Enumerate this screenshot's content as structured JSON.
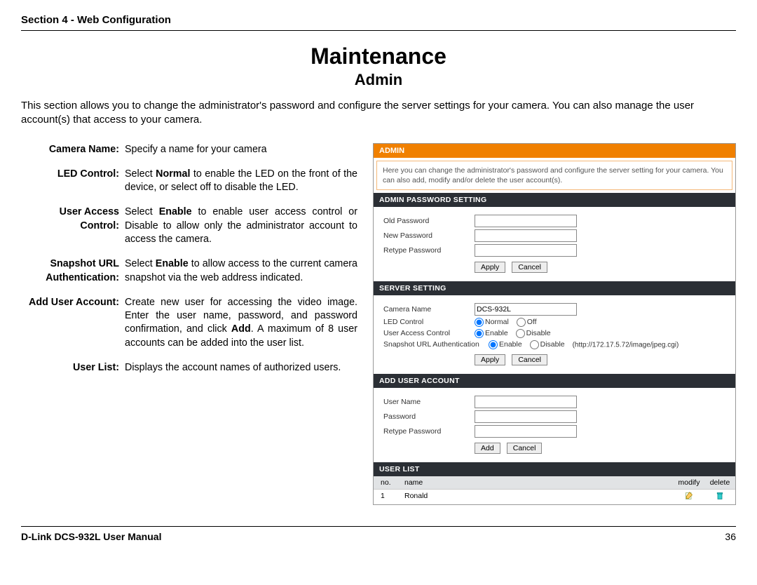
{
  "doc": {
    "section_header": "Section 4 - Web Configuration",
    "title": "Maintenance",
    "subtitle": "Admin",
    "intro": "This section allows you to change the administrator's password and configure the server settings for your camera. You can also manage the user account(s) that access to your camera.",
    "footer_left": "D-Link DCS-932L User Manual",
    "footer_right": "36"
  },
  "defs": {
    "camera_name": {
      "label": "Camera Name:",
      "text": "Specify a name for your camera"
    },
    "led_control": {
      "label": "LED Control:",
      "pre": "Select ",
      "bold1": "Normal",
      "post1": " to enable the LED on the front of the device, or select off to disable the LED."
    },
    "user_access": {
      "label": "User Access Control:",
      "pre": "Select ",
      "bold1": "Enable",
      "post1": " to enable user access control or Disable to allow only the administrator account to access the camera."
    },
    "snapshot": {
      "label": "Snapshot URL Authentication:",
      "pre": "Select ",
      "bold1": "Enable",
      "post1": " to allow access to the current camera snapshot via the web address indicated."
    },
    "add_user": {
      "label": "Add User Account:",
      "pre": "Create new user for accessing the video image.  Enter the user name, password, and password confirmation, and click ",
      "bold1": "Add",
      "post1": ". A maximum of 8 user accounts can be added into the user list."
    },
    "user_list": {
      "label": "User List:",
      "text": "Displays the account names of authorized users."
    }
  },
  "ss": {
    "admin_header": "ADMIN",
    "admin_desc": "Here you can change the administrator's password and configure the server setting for your camera. You can also add, modify and/or delete the user account(s).",
    "pwd": {
      "header": "ADMIN PASSWORD SETTING",
      "old": "Old Password",
      "new": "New Password",
      "retype": "Retype Password",
      "apply": "Apply",
      "cancel": "Cancel"
    },
    "server": {
      "header": "SERVER SETTING",
      "camera_name_label": "Camera Name",
      "camera_name_value": "DCS-932L",
      "led_label": "LED Control",
      "led_normal": "Normal",
      "led_off": "Off",
      "uac_label": "User Access Control",
      "uac_enable": "Enable",
      "uac_disable": "Disable",
      "snap_label": "Snapshot URL Authentication",
      "snap_enable": "Enable",
      "snap_disable": "Disable",
      "snap_url": "(http://172.17.5.72/image/jpeg.cgi)",
      "apply": "Apply",
      "cancel": "Cancel"
    },
    "adduser": {
      "header": "ADD USER ACCOUNT",
      "user_name": "User Name",
      "password": "Password",
      "retype": "Retype Password",
      "add": "Add",
      "cancel": "Cancel"
    },
    "userlist": {
      "header": "USER LIST",
      "col_no": "no.",
      "col_name": "name",
      "col_modify": "modify",
      "col_delete": "delete",
      "row1_no": "1",
      "row1_name": "Ronald"
    }
  }
}
